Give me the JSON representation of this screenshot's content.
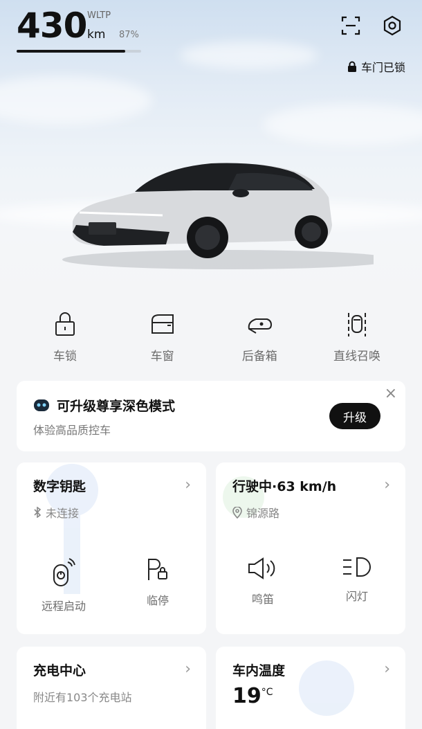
{
  "status": {
    "range_value": "430",
    "range_unit": "km",
    "standard": "WLTP",
    "battery_percent": "87%",
    "battery_level": 0.87,
    "lock_status": "车门已锁"
  },
  "icons": {
    "scan": "scan-icon",
    "settings": "settings-icon",
    "lock": "lock-icon"
  },
  "quick_actions": [
    {
      "label": "车锁",
      "icon": "lock-icon"
    },
    {
      "label": "车窗",
      "icon": "window-icon"
    },
    {
      "label": "后备箱",
      "icon": "trunk-icon"
    },
    {
      "label": "直线召唤",
      "icon": "summon-icon"
    }
  ],
  "promo": {
    "title": "可升级尊享深色模式",
    "subtitle": "体验高品质控车",
    "button": "升级",
    "close": "×"
  },
  "digital_key": {
    "title": "数字钥匙",
    "status": "未连接",
    "actions": [
      {
        "label": "远程启动",
        "icon": "remote-start-icon"
      },
      {
        "label": "临停",
        "icon": "parking-icon"
      }
    ]
  },
  "driving": {
    "title": "行驶中·63 km/h",
    "location": "锦源路",
    "actions": [
      {
        "label": "鸣笛",
        "icon": "horn-icon"
      },
      {
        "label": "闪灯",
        "icon": "headlight-icon"
      }
    ]
  },
  "charging": {
    "title": "充电中心",
    "subtitle": "附近有103个充电站"
  },
  "cabin_temp": {
    "title": "车内温度",
    "value": "19",
    "unit": "°C"
  },
  "colors": {
    "accent": "#111111",
    "card_bg": "#ffffff",
    "page_bg": "#f4f5f7"
  }
}
